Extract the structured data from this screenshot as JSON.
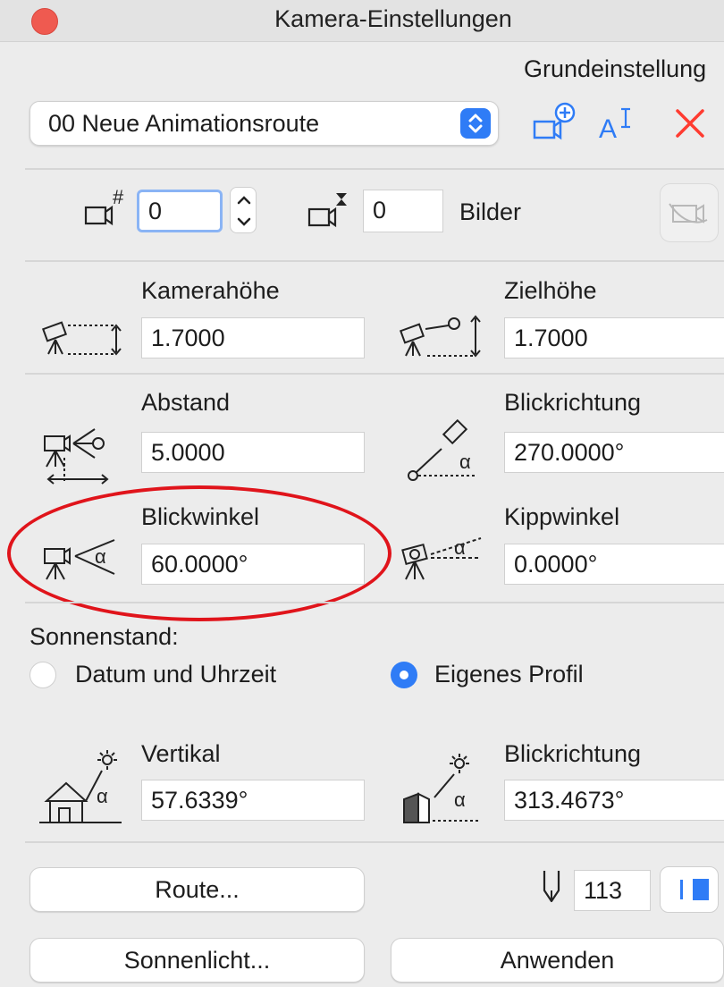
{
  "window": {
    "title": "Kamera-Einstellungen"
  },
  "section": {
    "label": "Grundeinstellung"
  },
  "route_select": {
    "value": "00  Neue Animationsroute"
  },
  "frame": {
    "number": "0",
    "count": "0",
    "unit": "Bilder"
  },
  "camera": {
    "height_label": "Kamerahöhe",
    "height_value": "1.7000",
    "target_label": "Zielhöhe",
    "target_value": "1.7000",
    "distance_label": "Abstand",
    "distance_value": "5.0000",
    "direction_label": "Blickrichtung",
    "direction_value": "270.0000°",
    "view_angle_label": "Blickwinkel",
    "view_angle_value": "60.0000°",
    "tilt_label": "Kippwinkel",
    "tilt_value": "0.0000°"
  },
  "sun": {
    "heading": "Sonnenstand:",
    "option_date": "Datum und Uhrzeit",
    "option_profile": "Eigenes Profil",
    "selected": "Eigenes Profil",
    "vertical_label": "Vertikal",
    "vertical_value": "57.6339°",
    "direction_label": "Blickrichtung",
    "direction_value": "313.4673°"
  },
  "footer": {
    "route_button": "Route...",
    "pen_value": "113",
    "sunlight_button": "Sonnenlicht...",
    "apply_button": "Anwenden"
  },
  "colors": {
    "accent": "#2f7cf6",
    "delete": "#ff3b30",
    "highlight_ellipse": "#e0141b",
    "close_dot": "#ef5a50"
  }
}
